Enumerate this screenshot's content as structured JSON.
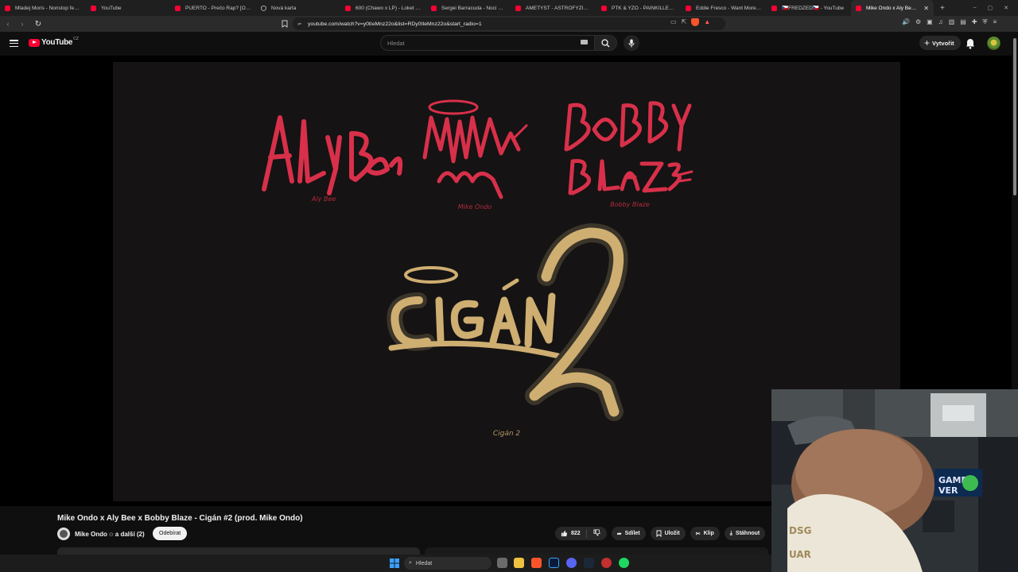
{
  "browser": {
    "tabs": [
      {
        "label": "Mladej Moris - Nonstop feat. ...",
        "icon": "youtube-icon",
        "active": false
      },
      {
        "label": "YouTube",
        "icon": "youtube-icon",
        "active": false
      },
      {
        "label": "PUERTO - Prečo Rap? [Official ...",
        "icon": "youtube-icon",
        "active": false
      },
      {
        "label": "Nová karta",
        "icon": "brave-shield-icon",
        "active": false
      },
      {
        "label": "600 (Chawo x LP) - Loket [Off...",
        "icon": "youtube-icon",
        "active": false
      },
      {
        "label": "Sergei Barracuda - Noci beze ...",
        "icon": "youtube-icon",
        "active": false
      },
      {
        "label": "AMETYST - ASTROFYZIK - You...",
        "icon": "youtube-icon",
        "active": false
      },
      {
        "label": "PTK & YZO - PAINKILLERS feat.",
        "icon": "youtube-icon",
        "active": false
      },
      {
        "label": "Eddie Fresco - Want More ft. ...",
        "icon": "youtube-icon",
        "active": false
      },
      {
        "label": "🇨🇿FREDZED🇨🇿 - YouTube",
        "icon": "youtube-icon",
        "active": false
      },
      {
        "label": "Mike Ondo x Aly Bee x ...",
        "icon": "youtube-icon",
        "active": true
      }
    ],
    "url": "youtube.com/watch?v=y0tIeMnz22o&list=RDy0tIeMnz22o&start_radio=1"
  },
  "youtube": {
    "logo_text": "YouTube",
    "country_code": "CZ",
    "search_placeholder": "Hledat",
    "create_label": "Vytvořit"
  },
  "video": {
    "art_artists": [
      "Aly Bee",
      "Mike Ondo",
      "Bobby Blaze"
    ],
    "art_title": "Cigán 2",
    "title": "Mike Ondo x Aly Bee x Bobby Blaze - Cigán #2 (prod. Mike Ondo)",
    "channel": "Mike Ondo",
    "channel_suffix": "a další (2)",
    "subscribe_label": "Odebírat",
    "like_count": "822",
    "share_label": "Sdílet",
    "save_label": "Uložit",
    "clip_label": "Klip",
    "download_label": "Stáhnout"
  },
  "taskbar": {
    "search_label": "Hledat"
  },
  "colors": {
    "youtube_red": "#ff0033",
    "graffiti_red": "#d8304a",
    "graffiti_gold": "#cfae72"
  }
}
